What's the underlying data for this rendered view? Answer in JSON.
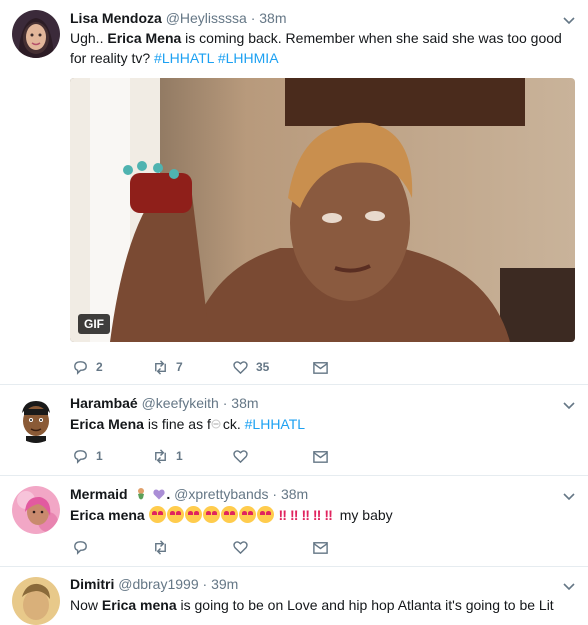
{
  "tweets": [
    {
      "name": "Lisa Mendoza",
      "handle": "@Heylissssa",
      "time": "· 38m",
      "text_before": "Ugh.. ",
      "highlight": "Erica Mena",
      "text_after": " is coming back. Remember when she said she was too good for reality tv? ",
      "hashtags": [
        "#LHHATL",
        "#LHHMIA"
      ],
      "media_badge": "GIF",
      "replies": "2",
      "retweets": "7",
      "likes": "35"
    },
    {
      "name": "Harambaé",
      "handle": "@keefykeith",
      "time": "· 38m",
      "highlight": "Erica Mena",
      "text_after": " is fine as f",
      "text_end": "ck. ",
      "hashtag": "#LHHATL",
      "replies": "1",
      "retweets": "1",
      "likes": ""
    },
    {
      "name": "Mermaid",
      "name_suffix": ".",
      "handle": "@xprettybands",
      "time": "· 38m",
      "highlight": "Erica mena",
      "text_after": "my baby",
      "replies": "",
      "retweets": "",
      "likes": ""
    },
    {
      "name": "Dimitri",
      "handle": "@dbray1999",
      "time": "· 39m",
      "text_before": "Now ",
      "highlight": "Erica mena",
      "text_after": " is going to be on Love and hip hop Atlanta it's going to be Lit"
    }
  ],
  "icons": {
    "reply": "reply-icon",
    "retweet": "retweet-icon",
    "like": "heart-icon",
    "dm": "envelope-icon",
    "caret": "chevron-down-icon"
  },
  "colors": {
    "link": "#1da1f2",
    "muted": "#657786",
    "border": "#e6ecf0"
  }
}
